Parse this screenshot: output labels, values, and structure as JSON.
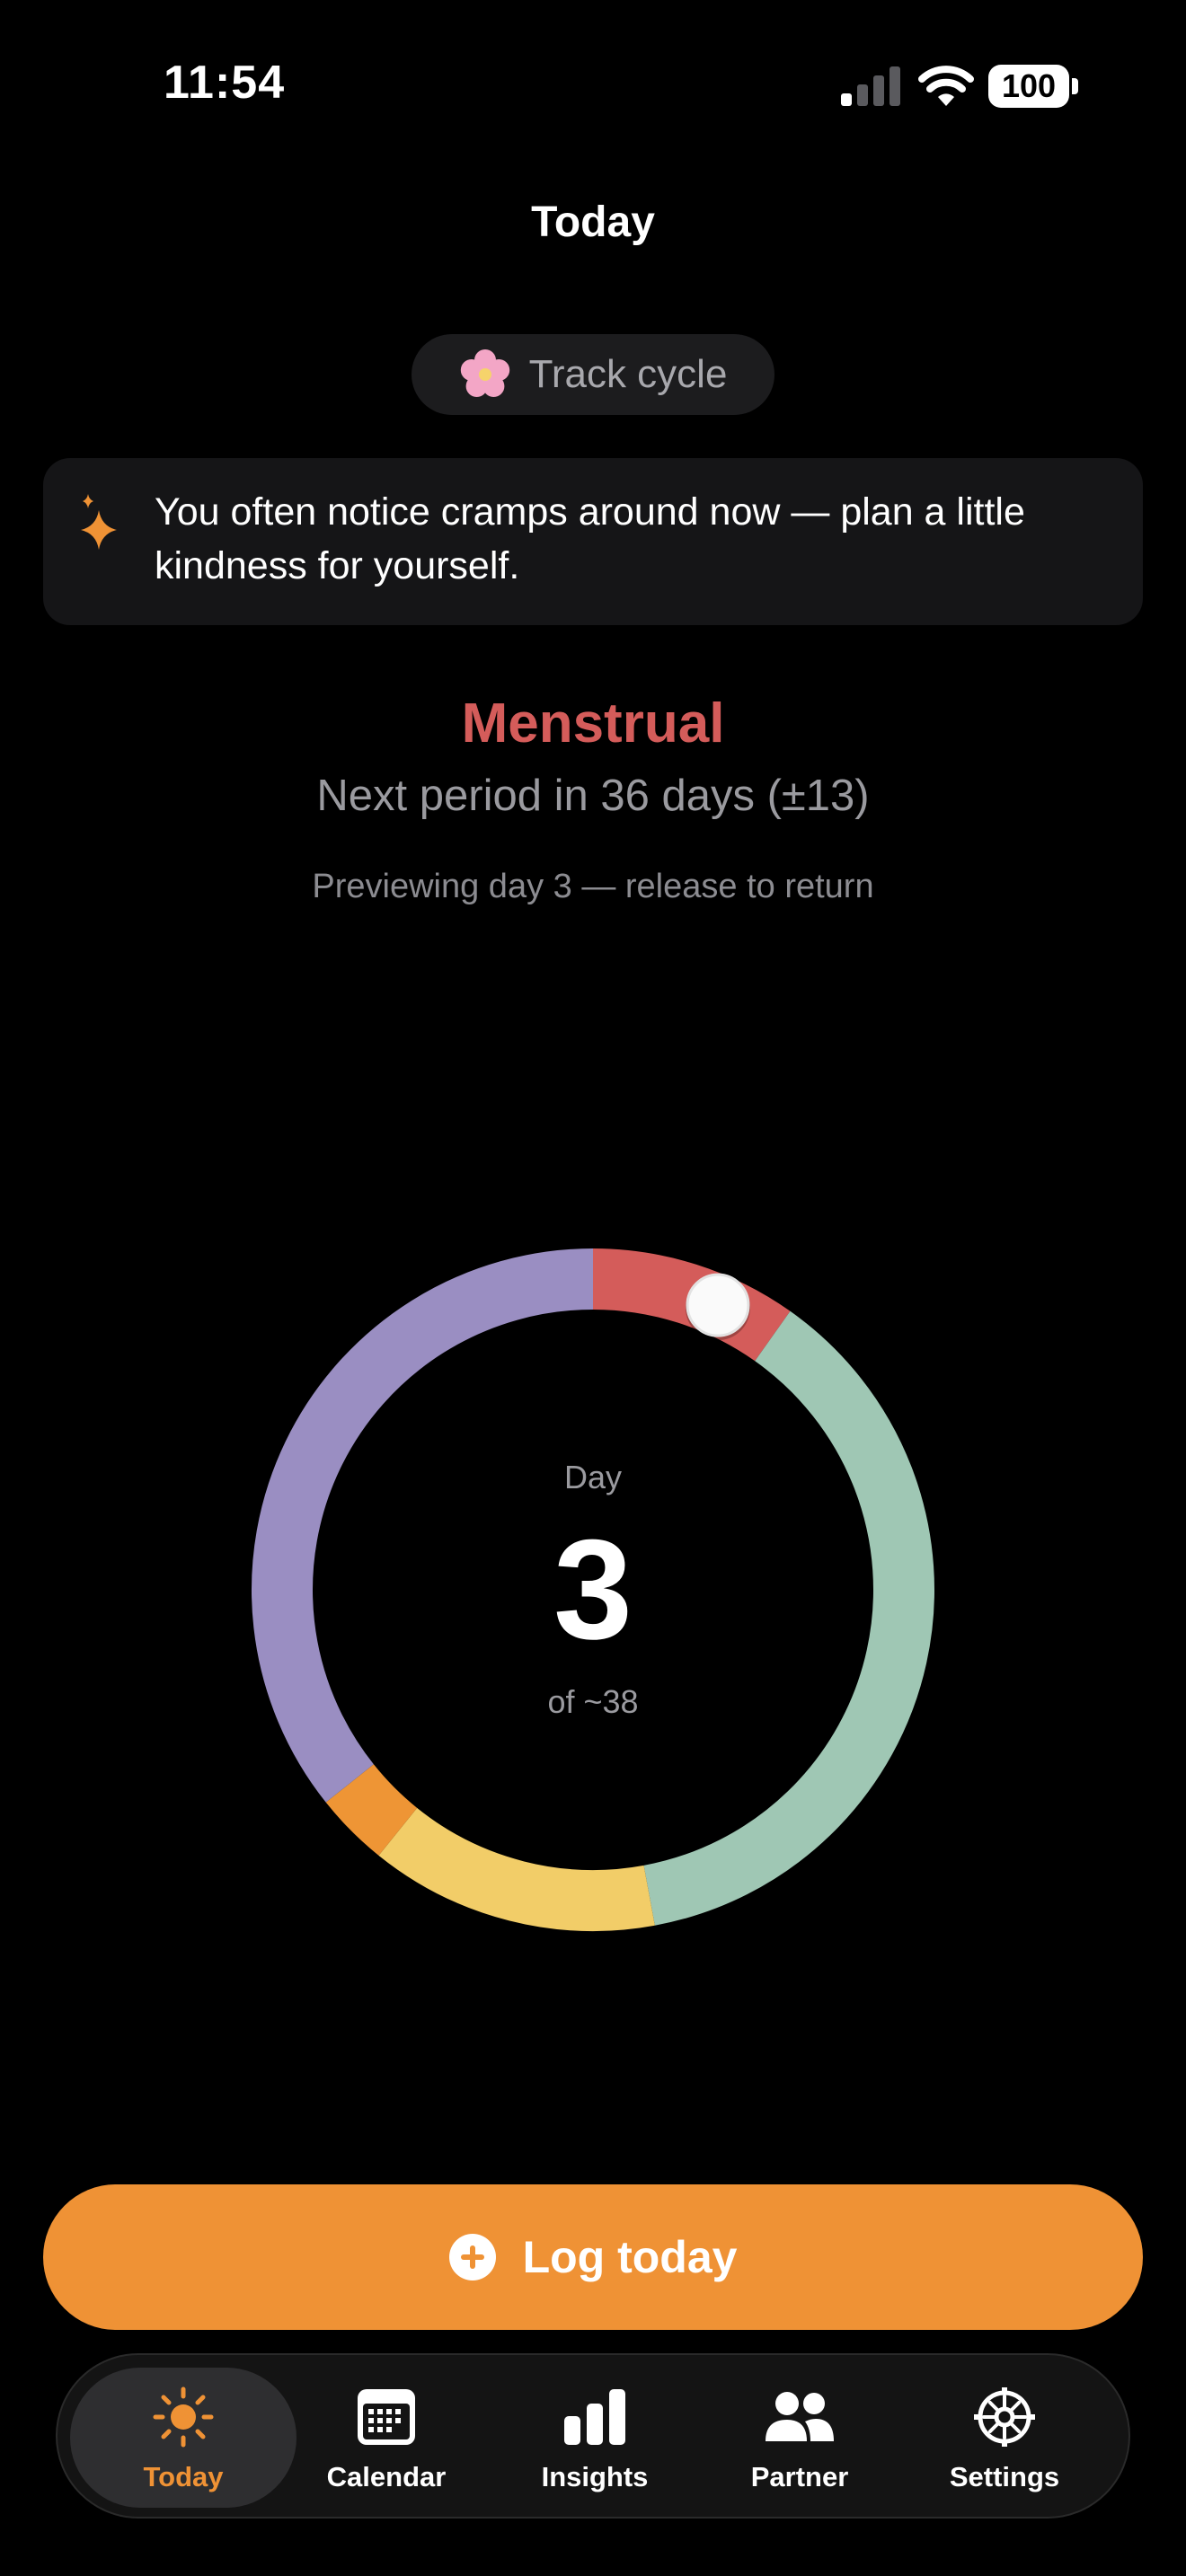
{
  "status_bar": {
    "time": "11:54",
    "battery": "100"
  },
  "header": {
    "title": "Today"
  },
  "track_pill": {
    "label": "Track cycle",
    "icon": "cherry-blossom-icon"
  },
  "insight": {
    "icon": "sparkles-icon",
    "text": "You often notice cramps around now — plan a little kindness for yourself."
  },
  "phase": {
    "name": "Menstrual",
    "next_period": "Next period in 36 days (±13)",
    "preview_note": "Previewing day 3 — release to return"
  },
  "cycle_ring": {
    "caption": "Day",
    "day": "3",
    "total_text": "of ~38",
    "current_day": 3,
    "cycle_length": 38,
    "segments": [
      {
        "phase": "menstrual",
        "fraction": 0.098,
        "color": "#d45c5a"
      },
      {
        "phase": "follicular",
        "fraction": 0.373,
        "color": "#9fc7b4"
      },
      {
        "phase": "ovulatory",
        "fraction": 0.137,
        "color": "#f2cd68"
      },
      {
        "phase": "fertile-peak",
        "fraction": 0.035,
        "color": "#ee9535"
      },
      {
        "phase": "luteal",
        "fraction": 0.357,
        "color": "#9a8ec2"
      }
    ]
  },
  "log_button": {
    "label": "Log today",
    "icon": "plus-circle-icon"
  },
  "tab_bar": {
    "items": [
      {
        "label": "Today",
        "icon": "sun-icon",
        "active": true
      },
      {
        "label": "Calendar",
        "icon": "calendar-icon",
        "active": false
      },
      {
        "label": "Insights",
        "icon": "bar-chart-icon",
        "active": false
      },
      {
        "label": "Partner",
        "icon": "people-icon",
        "active": false
      },
      {
        "label": "Settings",
        "icon": "gear-icon",
        "active": false
      }
    ]
  },
  "colors": {
    "accent": "#ef9235",
    "menstrual": "#d45c5a",
    "background": "#000000"
  }
}
